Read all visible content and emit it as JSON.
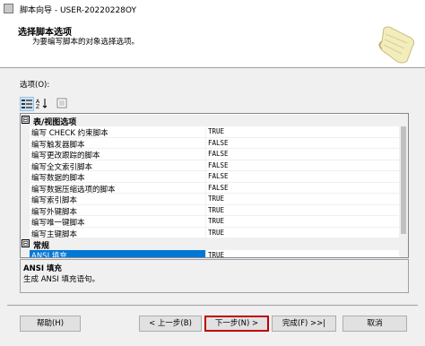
{
  "window": {
    "title": "脚本向导 - USER-20220228OY"
  },
  "header": {
    "title": "选择脚本选项",
    "subtitle": "为要编写脚本的对象选择选项。"
  },
  "options_label": "选项(O):",
  "categories": [
    {
      "label": "表/视图选项",
      "toggle": "⊟",
      "rows": [
        {
          "name": "编写 CHECK 约束脚本",
          "value": "TRUE"
        },
        {
          "name": "编写触发器脚本",
          "value": "FALSE"
        },
        {
          "name": "编写更改跟踪的脚本",
          "value": "FALSE"
        },
        {
          "name": "编写全文索引脚本",
          "value": "FALSE"
        },
        {
          "name": "编写数据的脚本",
          "value": "FALSE"
        },
        {
          "name": "编写数据压缩选项的脚本",
          "value": "FALSE"
        },
        {
          "name": "编写索引脚本",
          "value": "TRUE"
        },
        {
          "name": "编写外键脚本",
          "value": "TRUE"
        },
        {
          "name": "编写唯一键脚本",
          "value": "TRUE"
        },
        {
          "name": "编写主键脚本",
          "value": "TRUE"
        }
      ]
    },
    {
      "label": "常规",
      "toggle": "⊟",
      "rows": [
        {
          "name": "ANSI 填充",
          "value": "TRUE",
          "selected": true
        }
      ]
    }
  ],
  "description": {
    "title": "ANSI 填充",
    "text": "生成 ANSI 填充语句。"
  },
  "buttons": {
    "help": "帮助(H)",
    "back": "< 上一步(B)",
    "next": "下一步(N) >",
    "finish": "完成(F) >>|",
    "cancel": "取消"
  },
  "icons": {
    "app": "window-icon",
    "scroll": "scroll-graphic-icon",
    "categorized": "categorized-icon",
    "sort": "sort-az-icon",
    "pages": "property-pages-icon"
  }
}
